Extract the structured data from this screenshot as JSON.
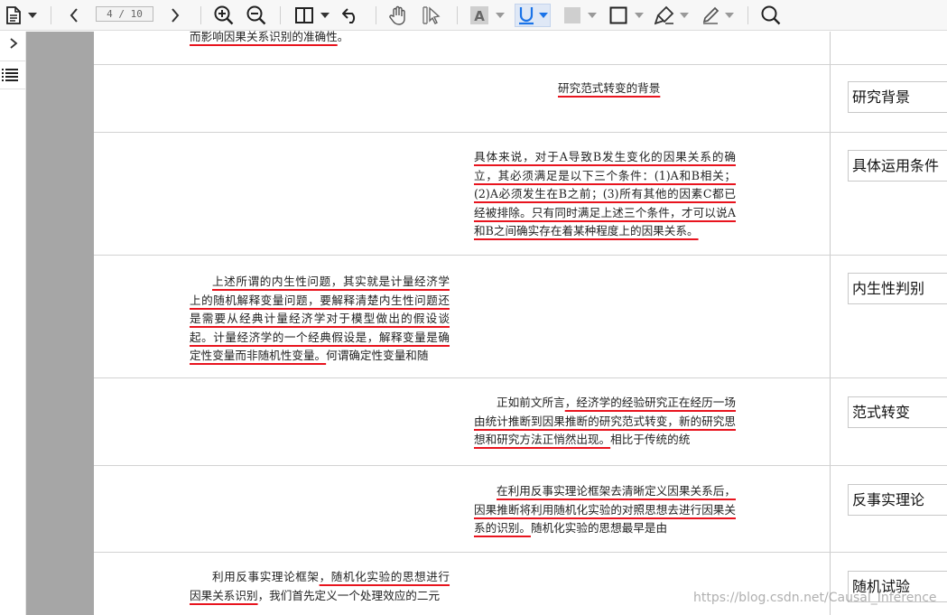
{
  "toolbar": {
    "page_indicator": "4 / 10",
    "icons": [
      "document-icon",
      "chevron-down-icon",
      "prev-page-icon",
      "next-page-icon",
      "zoom-in-icon",
      "zoom-out-icon",
      "sidebar-toggle-icon",
      "undo-icon",
      "hand-tool-icon",
      "select-tool-icon",
      "text-highlight-icon",
      "underline-icon",
      "fill-color-icon",
      "rectangle-icon",
      "highlighter-icon",
      "pen-icon",
      "search-icon"
    ]
  },
  "sidepanel": {
    "icons": [
      "expand-arrow-icon",
      "outline-list-icon"
    ]
  },
  "document": {
    "rows": [
      {
        "text_parts": [
          {
            "t": "而影响因果关系识别的准确性",
            "u": true
          },
          {
            "t": "。",
            "u": false
          }
        ],
        "tag": ""
      },
      {
        "text_parts": [
          {
            "t": "研究范式转变的背景",
            "u": true
          }
        ],
        "tag": "研究背景"
      },
      {
        "text_parts": [
          {
            "t": "具体来说，对于A导致B发生变化的因果关系的确立，其必须满足是以下三个条件：(1)A和B相关；(2)A必须发生在B之前；(3)所有其他的因素C都已经被排除。只有同时满足上述三个条件，才可以说A和B之间确实存在着某种程度上的因果关系。",
            "u": true
          }
        ],
        "tag": "具体运用条件"
      },
      {
        "text_parts": [
          {
            "t": "上述所谓的内生性问题，其实就是计量经济学上的随机解释变量问题，要解释清楚内生性问题还是需要从经典计量经济学对于模型做出的假设谈起。计量经济学的一个经典假设是，解释变量是确定性变量而非随机性变量。",
            "u": true
          },
          {
            "t": "何谓确定性变量和随",
            "u": false
          }
        ],
        "tag": "内生性判别"
      },
      {
        "text_parts": [
          {
            "t": "正如前文所言",
            "u": false
          },
          {
            "t": "，经济学的经验研究正在经历一场由统计推断到因果推断的研究范式转变，新的研究思想和研究方法正悄然出现。",
            "u": true
          },
          {
            "t": "相比于传统的统",
            "u": false
          }
        ],
        "tag": "范式转变"
      },
      {
        "text_parts": [
          {
            "t": "在利用反事实理论框架去清晰定义因果关系后，因果推断将利用随机化实验的对照思想去进行因果关系的识别。",
            "u": true
          },
          {
            "t": "随机化实验的思想最早是由",
            "u": false
          }
        ],
        "tag": "反事实理论"
      },
      {
        "text_parts": [
          {
            "t": "利用反事实理论框架",
            "u": false
          },
          {
            "t": "，随机化实验的思想进行因果关系识别",
            "u": true
          },
          {
            "t": "，我们首先定义一个处理效应的二元",
            "u": false
          }
        ],
        "tag": "随机试验"
      }
    ],
    "watermark": "https://blog.csdn.net/Causal_Inference"
  },
  "colors": {
    "underline": "#e8141e",
    "accent_underline_tool": "#1a73e8",
    "gray_band": "#a6a6a6"
  }
}
